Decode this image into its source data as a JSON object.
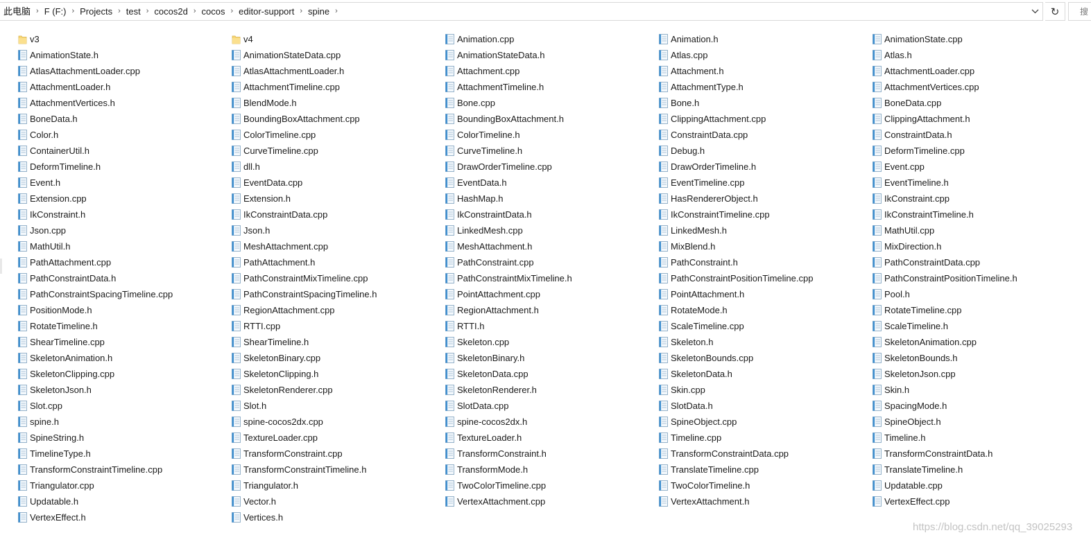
{
  "address_bar": {
    "crumbs": [
      "此电脑",
      "F (F:)",
      "Projects",
      "test",
      "cocos2d",
      "cocos",
      "editor-support",
      "spine"
    ],
    "refresh_glyph": "↻",
    "search_placeholder": "搜"
  },
  "files": [
    {
      "name": "v3",
      "type": "folder"
    },
    {
      "name": "v4",
      "type": "folder"
    },
    {
      "name": "Animation.cpp",
      "type": "file"
    },
    {
      "name": "Animation.h",
      "type": "file"
    },
    {
      "name": "AnimationState.cpp",
      "type": "file"
    },
    {
      "name": "AnimationState.h",
      "type": "file"
    },
    {
      "name": "AnimationStateData.cpp",
      "type": "file"
    },
    {
      "name": "AnimationStateData.h",
      "type": "file"
    },
    {
      "name": "Atlas.cpp",
      "type": "file"
    },
    {
      "name": "Atlas.h",
      "type": "file"
    },
    {
      "name": "AtlasAttachmentLoader.cpp",
      "type": "file"
    },
    {
      "name": "AtlasAttachmentLoader.h",
      "type": "file"
    },
    {
      "name": "Attachment.cpp",
      "type": "file"
    },
    {
      "name": "Attachment.h",
      "type": "file"
    },
    {
      "name": "AttachmentLoader.cpp",
      "type": "file"
    },
    {
      "name": "AttachmentLoader.h",
      "type": "file"
    },
    {
      "name": "AttachmentTimeline.cpp",
      "type": "file"
    },
    {
      "name": "AttachmentTimeline.h",
      "type": "file"
    },
    {
      "name": "AttachmentType.h",
      "type": "file"
    },
    {
      "name": "AttachmentVertices.cpp",
      "type": "file"
    },
    {
      "name": "AttachmentVertices.h",
      "type": "file"
    },
    {
      "name": "BlendMode.h",
      "type": "file"
    },
    {
      "name": "Bone.cpp",
      "type": "file"
    },
    {
      "name": "Bone.h",
      "type": "file"
    },
    {
      "name": "BoneData.cpp",
      "type": "file"
    },
    {
      "name": "BoneData.h",
      "type": "file"
    },
    {
      "name": "BoundingBoxAttachment.cpp",
      "type": "file"
    },
    {
      "name": "BoundingBoxAttachment.h",
      "type": "file"
    },
    {
      "name": "ClippingAttachment.cpp",
      "type": "file"
    },
    {
      "name": "ClippingAttachment.h",
      "type": "file"
    },
    {
      "name": "Color.h",
      "type": "file"
    },
    {
      "name": "ColorTimeline.cpp",
      "type": "file"
    },
    {
      "name": "ColorTimeline.h",
      "type": "file"
    },
    {
      "name": "ConstraintData.cpp",
      "type": "file"
    },
    {
      "name": "ConstraintData.h",
      "type": "file"
    },
    {
      "name": "ContainerUtil.h",
      "type": "file"
    },
    {
      "name": "CurveTimeline.cpp",
      "type": "file"
    },
    {
      "name": "CurveTimeline.h",
      "type": "file"
    },
    {
      "name": "Debug.h",
      "type": "file"
    },
    {
      "name": "DeformTimeline.cpp",
      "type": "file"
    },
    {
      "name": "DeformTimeline.h",
      "type": "file"
    },
    {
      "name": "dll.h",
      "type": "file"
    },
    {
      "name": "DrawOrderTimeline.cpp",
      "type": "file"
    },
    {
      "name": "DrawOrderTimeline.h",
      "type": "file"
    },
    {
      "name": "Event.cpp",
      "type": "file"
    },
    {
      "name": "Event.h",
      "type": "file"
    },
    {
      "name": "EventData.cpp",
      "type": "file"
    },
    {
      "name": "EventData.h",
      "type": "file"
    },
    {
      "name": "EventTimeline.cpp",
      "type": "file"
    },
    {
      "name": "EventTimeline.h",
      "type": "file"
    },
    {
      "name": "Extension.cpp",
      "type": "file"
    },
    {
      "name": "Extension.h",
      "type": "file"
    },
    {
      "name": "HashMap.h",
      "type": "file"
    },
    {
      "name": "HasRendererObject.h",
      "type": "file"
    },
    {
      "name": "IkConstraint.cpp",
      "type": "file"
    },
    {
      "name": "IkConstraint.h",
      "type": "file"
    },
    {
      "name": "IkConstraintData.cpp",
      "type": "file"
    },
    {
      "name": "IkConstraintData.h",
      "type": "file"
    },
    {
      "name": "IkConstraintTimeline.cpp",
      "type": "file"
    },
    {
      "name": "IkConstraintTimeline.h",
      "type": "file"
    },
    {
      "name": "Json.cpp",
      "type": "file"
    },
    {
      "name": "Json.h",
      "type": "file"
    },
    {
      "name": "LinkedMesh.cpp",
      "type": "file"
    },
    {
      "name": "LinkedMesh.h",
      "type": "file"
    },
    {
      "name": "MathUtil.cpp",
      "type": "file"
    },
    {
      "name": "MathUtil.h",
      "type": "file"
    },
    {
      "name": "MeshAttachment.cpp",
      "type": "file"
    },
    {
      "name": "MeshAttachment.h",
      "type": "file"
    },
    {
      "name": "MixBlend.h",
      "type": "file"
    },
    {
      "name": "MixDirection.h",
      "type": "file"
    },
    {
      "name": "PathAttachment.cpp",
      "type": "file"
    },
    {
      "name": "PathAttachment.h",
      "type": "file"
    },
    {
      "name": "PathConstraint.cpp",
      "type": "file"
    },
    {
      "name": "PathConstraint.h",
      "type": "file"
    },
    {
      "name": "PathConstraintData.cpp",
      "type": "file"
    },
    {
      "name": "PathConstraintData.h",
      "type": "file"
    },
    {
      "name": "PathConstraintMixTimeline.cpp",
      "type": "file"
    },
    {
      "name": "PathConstraintMixTimeline.h",
      "type": "file"
    },
    {
      "name": "PathConstraintPositionTimeline.cpp",
      "type": "file"
    },
    {
      "name": "PathConstraintPositionTimeline.h",
      "type": "file"
    },
    {
      "name": "PathConstraintSpacingTimeline.cpp",
      "type": "file"
    },
    {
      "name": "PathConstraintSpacingTimeline.h",
      "type": "file"
    },
    {
      "name": "PointAttachment.cpp",
      "type": "file"
    },
    {
      "name": "PointAttachment.h",
      "type": "file"
    },
    {
      "name": "Pool.h",
      "type": "file"
    },
    {
      "name": "PositionMode.h",
      "type": "file"
    },
    {
      "name": "RegionAttachment.cpp",
      "type": "file"
    },
    {
      "name": "RegionAttachment.h",
      "type": "file"
    },
    {
      "name": "RotateMode.h",
      "type": "file"
    },
    {
      "name": "RotateTimeline.cpp",
      "type": "file"
    },
    {
      "name": "RotateTimeline.h",
      "type": "file"
    },
    {
      "name": "RTTI.cpp",
      "type": "file"
    },
    {
      "name": "RTTI.h",
      "type": "file"
    },
    {
      "name": "ScaleTimeline.cpp",
      "type": "file"
    },
    {
      "name": "ScaleTimeline.h",
      "type": "file"
    },
    {
      "name": "ShearTimeline.cpp",
      "type": "file"
    },
    {
      "name": "ShearTimeline.h",
      "type": "file"
    },
    {
      "name": "Skeleton.cpp",
      "type": "file"
    },
    {
      "name": "Skeleton.h",
      "type": "file"
    },
    {
      "name": "SkeletonAnimation.cpp",
      "type": "file"
    },
    {
      "name": "SkeletonAnimation.h",
      "type": "file"
    },
    {
      "name": "SkeletonBinary.cpp",
      "type": "file"
    },
    {
      "name": "SkeletonBinary.h",
      "type": "file"
    },
    {
      "name": "SkeletonBounds.cpp",
      "type": "file"
    },
    {
      "name": "SkeletonBounds.h",
      "type": "file"
    },
    {
      "name": "SkeletonClipping.cpp",
      "type": "file"
    },
    {
      "name": "SkeletonClipping.h",
      "type": "file"
    },
    {
      "name": "SkeletonData.cpp",
      "type": "file"
    },
    {
      "name": "SkeletonData.h",
      "type": "file"
    },
    {
      "name": "SkeletonJson.cpp",
      "type": "file"
    },
    {
      "name": "SkeletonJson.h",
      "type": "file"
    },
    {
      "name": "SkeletonRenderer.cpp",
      "type": "file"
    },
    {
      "name": "SkeletonRenderer.h",
      "type": "file"
    },
    {
      "name": "Skin.cpp",
      "type": "file"
    },
    {
      "name": "Skin.h",
      "type": "file"
    },
    {
      "name": "Slot.cpp",
      "type": "file"
    },
    {
      "name": "Slot.h",
      "type": "file"
    },
    {
      "name": "SlotData.cpp",
      "type": "file"
    },
    {
      "name": "SlotData.h",
      "type": "file"
    },
    {
      "name": "SpacingMode.h",
      "type": "file"
    },
    {
      "name": "spine.h",
      "type": "file"
    },
    {
      "name": "spine-cocos2dx.cpp",
      "type": "file"
    },
    {
      "name": "spine-cocos2dx.h",
      "type": "file"
    },
    {
      "name": "SpineObject.cpp",
      "type": "file"
    },
    {
      "name": "SpineObject.h",
      "type": "file"
    },
    {
      "name": "SpineString.h",
      "type": "file"
    },
    {
      "name": "TextureLoader.cpp",
      "type": "file"
    },
    {
      "name": "TextureLoader.h",
      "type": "file"
    },
    {
      "name": "Timeline.cpp",
      "type": "file"
    },
    {
      "name": "Timeline.h",
      "type": "file"
    },
    {
      "name": "TimelineType.h",
      "type": "file"
    },
    {
      "name": "TransformConstraint.cpp",
      "type": "file"
    },
    {
      "name": "TransformConstraint.h",
      "type": "file"
    },
    {
      "name": "TransformConstraintData.cpp",
      "type": "file"
    },
    {
      "name": "TransformConstraintData.h",
      "type": "file"
    },
    {
      "name": "TransformConstraintTimeline.cpp",
      "type": "file"
    },
    {
      "name": "TransformConstraintTimeline.h",
      "type": "file"
    },
    {
      "name": "TransformMode.h",
      "type": "file"
    },
    {
      "name": "TranslateTimeline.cpp",
      "type": "file"
    },
    {
      "name": "TranslateTimeline.h",
      "type": "file"
    },
    {
      "name": "Triangulator.cpp",
      "type": "file"
    },
    {
      "name": "Triangulator.h",
      "type": "file"
    },
    {
      "name": "TwoColorTimeline.cpp",
      "type": "file"
    },
    {
      "name": "TwoColorTimeline.h",
      "type": "file"
    },
    {
      "name": "Updatable.cpp",
      "type": "file"
    },
    {
      "name": "Updatable.h",
      "type": "file"
    },
    {
      "name": "Vector.h",
      "type": "file"
    },
    {
      "name": "VertexAttachment.cpp",
      "type": "file"
    },
    {
      "name": "VertexAttachment.h",
      "type": "file"
    },
    {
      "name": "VertexEffect.cpp",
      "type": "file"
    },
    {
      "name": "VertexEffect.h",
      "type": "file"
    },
    {
      "name": "Vertices.h",
      "type": "file"
    }
  ],
  "watermark": "https://blog.csdn.net/qq_39025293",
  "colors": {
    "folder_fill": "#f8d775",
    "file_page": "#f4f9fd",
    "file_strip": "#3f8fcf",
    "border": "#d9d9d9"
  }
}
